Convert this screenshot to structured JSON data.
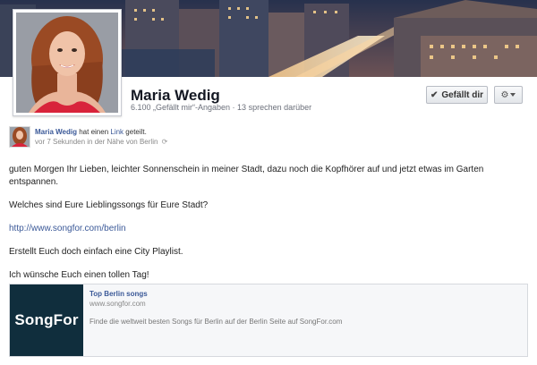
{
  "page": {
    "name": "Maria Wedig",
    "stats": "6.100 „Gefällt mir“-Angaben · 13 sprechen darüber",
    "like_label": "Gefällt dir",
    "like_icon": "checkmark-icon",
    "settings_icon": "gear-icon"
  },
  "post": {
    "author": "Maria Wedig",
    "action_prefix": "hat einen",
    "link_word": "Link",
    "action_suffix": "geteilt.",
    "timestamp": "vor 7 Sekunden in der Nähe von Berlin",
    "paragraphs": {
      "p1": "guten Morgen Ihr Lieben, leichter Sonnenschein in meiner Stadt, dazu noch die Kopfhörer auf und jetzt etwas im Garten entspannen.",
      "p2": "Welches sind Eure Lieblingssongs für Eure Stadt?",
      "url": "http://www.songfor.com/berlin",
      "p3": "Erstellt Euch doch einfach eine City Playlist.",
      "p4": "Ich wünsche Euch einen tollen Tag!"
    }
  },
  "preview": {
    "thumb_text": "SongFor",
    "title": "Top Berlin songs",
    "domain": "www.songfor.com",
    "description": "Finde die weltweit besten Songs für Berlin auf der Berlin Seite auf SongFor.com"
  },
  "colors": {
    "link_blue": "#3b5998",
    "thumb_bg": "#102e3d"
  }
}
